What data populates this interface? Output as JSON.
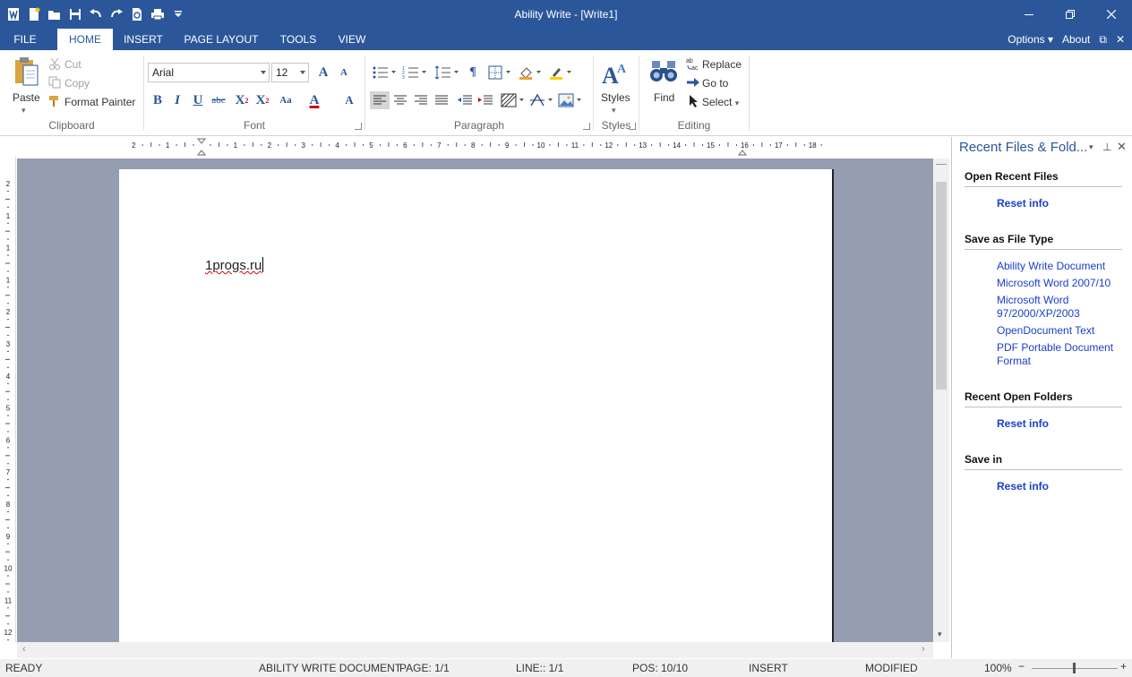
{
  "window": {
    "title": "Ability Write - [Write1]"
  },
  "tabs": {
    "file": "FILE",
    "home": "HOME",
    "insert": "INSERT",
    "page_layout": "PAGE LAYOUT",
    "tools": "TOOLS",
    "view": "VIEW"
  },
  "tabs_right": {
    "options": "Options",
    "about": "About"
  },
  "clipboard": {
    "paste": "Paste",
    "cut": "Cut",
    "copy": "Copy",
    "format_painter": "Format Painter",
    "label": "Clipboard"
  },
  "font": {
    "family": "Arial",
    "size": "12",
    "label": "Font"
  },
  "paragraph": {
    "label": "Paragraph"
  },
  "styles": {
    "button": "Styles",
    "label": "Styles"
  },
  "editing": {
    "find": "Find",
    "replace": "Replace",
    "goto": "Go to",
    "select": "Select",
    "label": "Editing"
  },
  "hruler_numbers": [
    "2",
    "1",
    "1",
    "2",
    "3",
    "4",
    "5",
    "6",
    "7",
    "8",
    "9",
    "10",
    "11",
    "12",
    "13",
    "14",
    "15",
    "16",
    "17",
    "18"
  ],
  "vruler_numbers": [
    "2",
    "1",
    "1",
    "1",
    "2",
    "3",
    "4",
    "5",
    "6",
    "7",
    "8",
    "9",
    "10",
    "11",
    "12"
  ],
  "document": {
    "text": "1progs.ru"
  },
  "panel": {
    "title": "Recent Files & Fold...",
    "sections": [
      {
        "heading": "Open Recent Files",
        "links": [
          "Reset info"
        ]
      },
      {
        "heading": "Save as File Type",
        "links": [
          "Ability Write Document",
          "Microsoft Word 2007/10",
          "Microsoft Word 97/2000/XP/2003",
          "OpenDocument Text",
          "PDF Portable Document Format"
        ]
      },
      {
        "heading": "Recent Open Folders",
        "links": [
          "Reset info"
        ]
      },
      {
        "heading": "Save in",
        "links": [
          "Reset info"
        ]
      }
    ]
  },
  "status": {
    "ready": "READY",
    "doctype": "ABILITY WRITE DOCUMENT",
    "page": "PAGE: 1/1",
    "line": "LINE:: 1/1",
    "pos": "POS: 10/10",
    "mode": "INSERT",
    "modified": "MODIFIED",
    "zoom": "100%"
  },
  "colors": {
    "accent": "#2b579a",
    "link": "#1a3fc8",
    "canvas": "#959db1"
  }
}
